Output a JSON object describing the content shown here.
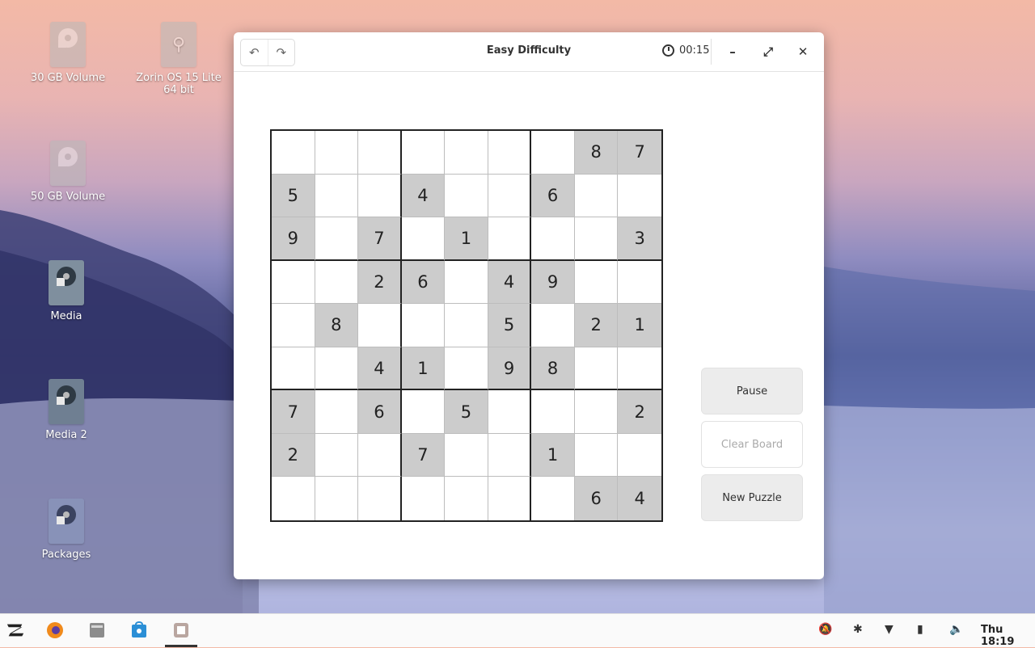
{
  "desktop": {
    "icons": [
      {
        "label": "30 GB Volume"
      },
      {
        "label": "Zorin OS 15 Lite 64 bit"
      },
      {
        "label": "50 GB Volume"
      },
      {
        "label": "Media"
      },
      {
        "label": "Media 2"
      },
      {
        "label": "Packages"
      }
    ]
  },
  "window": {
    "title": "Easy Difficulty",
    "timer": "00:15",
    "undo_icon": "undo-icon",
    "redo_icon": "redo-icon"
  },
  "board": {
    "rows": [
      [
        "",
        "",
        "",
        "",
        "",
        "",
        "",
        "8",
        "7"
      ],
      [
        "5",
        "",
        "",
        "4",
        "",
        "",
        "6",
        "",
        ""
      ],
      [
        "9",
        "",
        "7",
        "",
        "1",
        "",
        "",
        "",
        "3"
      ],
      [
        "",
        "",
        "2",
        "6",
        "",
        "4",
        "9",
        "",
        ""
      ],
      [
        "",
        "8",
        "",
        "",
        "",
        "5",
        "",
        "2",
        "1"
      ],
      [
        "",
        "",
        "4",
        "1",
        "",
        "9",
        "8",
        "",
        ""
      ],
      [
        "7",
        "",
        "6",
        "",
        "5",
        "",
        "",
        "",
        "2"
      ],
      [
        "2",
        "",
        "",
        "7",
        "",
        "",
        "1",
        "",
        ""
      ],
      [
        "",
        "",
        "",
        "",
        "",
        "",
        "",
        "6",
        "4"
      ]
    ]
  },
  "controls": {
    "pause": "Pause",
    "clear_board": "Clear Board",
    "new_puzzle": "New Puzzle"
  },
  "taskbar": {
    "clock": "Thu 18:19"
  }
}
